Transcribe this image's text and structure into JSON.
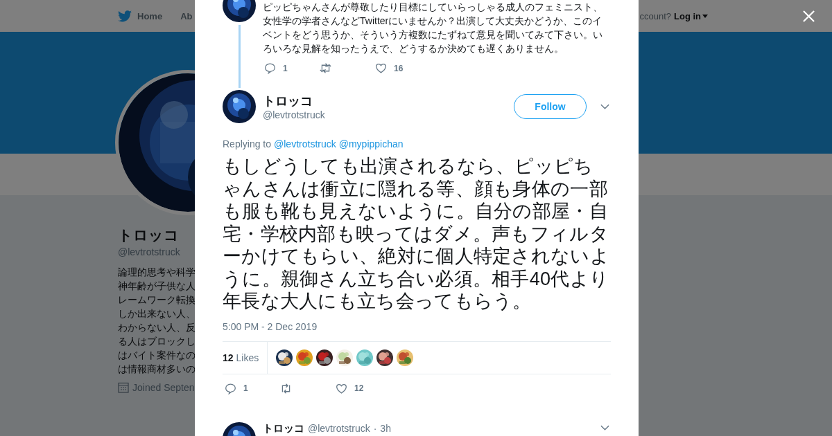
{
  "nav": {
    "items": [
      {
        "label": "Home",
        "selected": false
      },
      {
        "label": "Ab",
        "selected": false
      }
    ],
    "account_prompt": "ccount?",
    "login": "Log in"
  },
  "profile": {
    "name": "トロッコ",
    "handle": "@levtrotstruck",
    "bio_lines": [
      "論理的思考や科学",
      "神年齢が子供な人",
      "レームワーク転換",
      "しか出来ない人、",
      "わからない人、反",
      "る人はブロックし",
      "はバイト案件なの",
      "は情報商材多いの"
    ],
    "joined": "Joined Septen"
  },
  "previous_tweet": {
    "text": "ピッピちゃんさんが尊敬したり目標にしていらっしゃる成人のフェミニスト、女性学の学者さんなどTwitterにいませんか？出演して大丈夫かどうか、このイベントをどう思うか、そういう方複数にたずねて意見を聞いてみて下さい。いろいろな見解を知ったうえで、どうするか決めても遅くありません。",
    "replies": "1",
    "likes": "16"
  },
  "tweet": {
    "name": "トロッコ",
    "handle": "@levtrotstruck",
    "follow": "Follow",
    "replying_label": "Replying to",
    "replying_to": [
      "@levtrotstruck",
      "@mypippichan"
    ],
    "text": "もしどうしても出演されるなら、ピッピちゃんさんは衝立に隠れる等、顔も身体の一部も服も靴も見えないように。自分の部屋・自宅・学校内部も映ってはダメ。声もフィルターかけてもらい、絶対に個人特定されないように。親御さん立ち合い必須。相手40代より年長な大人にも立ち会ってもらう。",
    "timestamp": "5:00 PM - 2 Dec 2019",
    "likes_count": "12",
    "likes_label": "Likes",
    "replies": "1",
    "likes": "12"
  },
  "next_tweet": {
    "name": "トロッコ",
    "handle": "@levtrotstruck",
    "dot": "·",
    "time": "3h"
  }
}
